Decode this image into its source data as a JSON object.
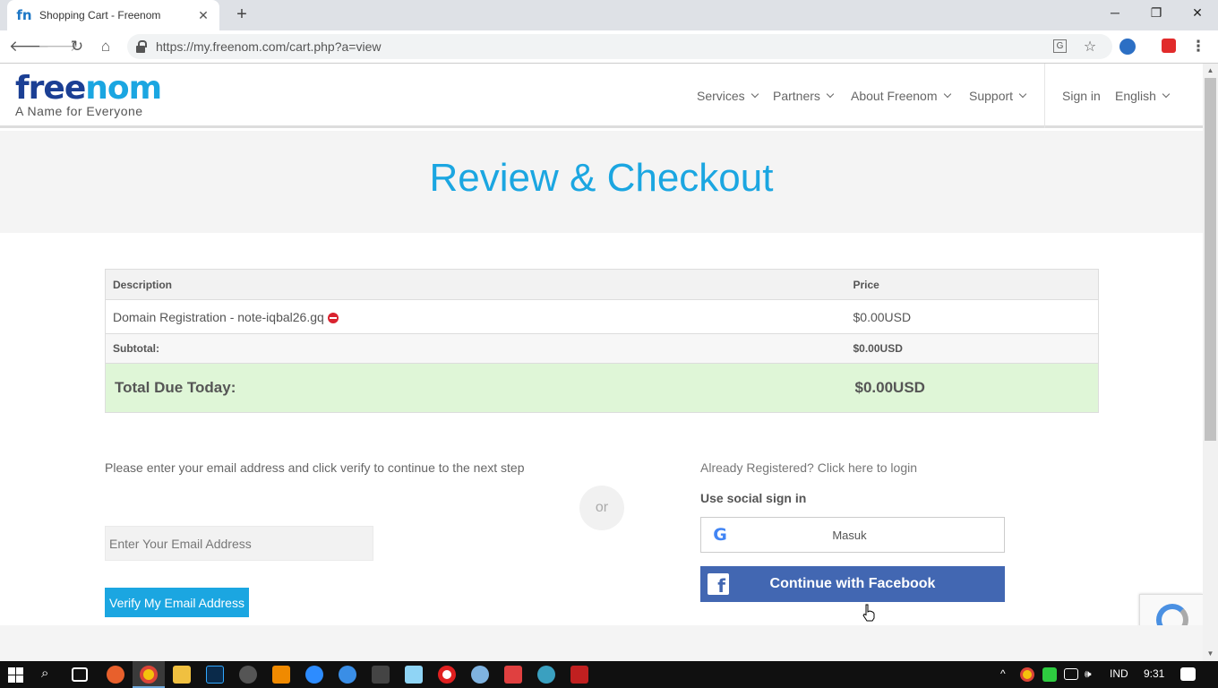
{
  "browser": {
    "tab_title": "Shopping Cart - Freenom",
    "favicon_text": "fn",
    "url": "https://my.freenom.com/cart.php?a=view",
    "new_tab_symbol": "+",
    "minimize_symbol": "─",
    "restore_symbol": "❐",
    "close_symbol": "✕",
    "tab_close_symbol": "✕"
  },
  "site": {
    "logo_part1": "free",
    "logo_part2": "nom",
    "tagline": "A Name for Everyone",
    "nav": [
      {
        "label": "Services"
      },
      {
        "label": "Partners"
      },
      {
        "label": "About Freenom"
      },
      {
        "label": "Support"
      }
    ],
    "sign_in": "Sign in",
    "language": "English"
  },
  "hero": {
    "title": "Review & Checkout"
  },
  "cart": {
    "headers": {
      "description": "Description",
      "price": "Price"
    },
    "items": [
      {
        "description": "Domain Registration - note-iqbal26.gq",
        "price": "$0.00USD"
      }
    ],
    "subtotal_label": "Subtotal:",
    "subtotal_value": "$0.00USD",
    "total_label": "Total Due Today:",
    "total_value": "$0.00USD"
  },
  "checkout": {
    "intro": "Please enter your email address and click verify to continue to the next step",
    "or_label": "or",
    "email_placeholder": "Enter Your Email Address",
    "verify_label": "Verify My Email Address",
    "login_link": "Already Registered? Click here to login",
    "social_label": "Use social sign in",
    "google_label": "Masuk",
    "facebook_label": "Continue with Facebook"
  },
  "taskbar": {
    "language": "IND",
    "time": "9:31"
  },
  "colors": {
    "accent": "#1ba6e1",
    "logo_dark": "#1b3f94",
    "total_bg": "#dff6d7",
    "facebook": "#4267b2",
    "remove": "#d9232f"
  }
}
